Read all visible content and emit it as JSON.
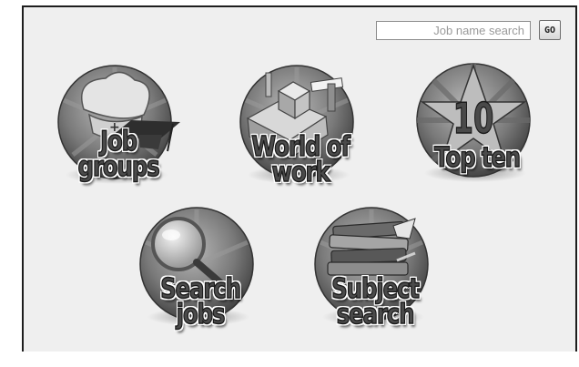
{
  "search": {
    "placeholder": "Job name search",
    "go_label": "GO"
  },
  "tiles": [
    {
      "line1": "Job",
      "line2": "groups",
      "icon": "chef-hat-graduation-cap-icon"
    },
    {
      "line1": "World of",
      "line2": "work",
      "icon": "city-buildings-icon"
    },
    {
      "line1": "Top ten",
      "line2": "",
      "icon": "star-ten-icon"
    },
    {
      "line1": "Search",
      "line2": "jobs",
      "icon": "magnifying-glass-icon"
    },
    {
      "line1": "Subject",
      "line2": "search",
      "icon": "stacked-books-icon"
    }
  ],
  "colors": {
    "background": "#efefef",
    "frame_border": "#1e1e1e",
    "label_fill": "#4a4a4a"
  }
}
